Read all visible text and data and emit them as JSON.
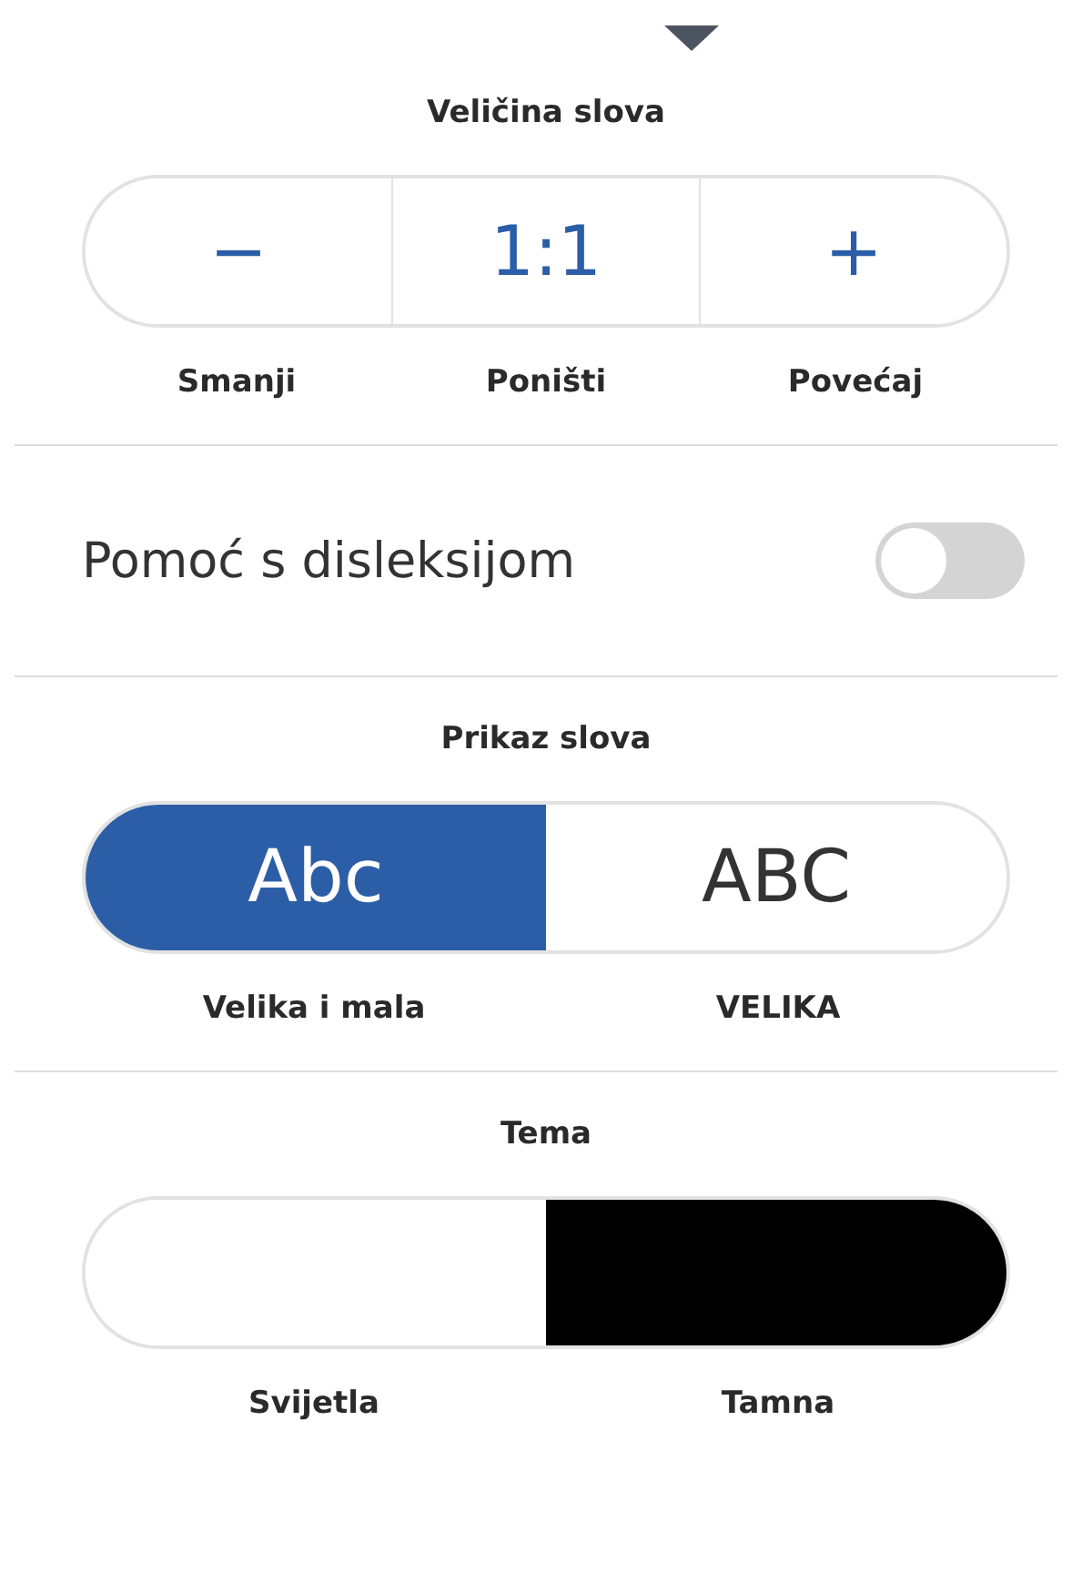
{
  "font_size": {
    "title": "Veličina slova",
    "buttons": [
      {
        "symbol": "−",
        "label": "Smanji"
      },
      {
        "symbol": "1:1",
        "label": "Poništi"
      },
      {
        "symbol": "+",
        "label": "Povećaj"
      }
    ]
  },
  "dyslexia": {
    "label": "Pomoć s disleksijom",
    "on": false
  },
  "letter_case": {
    "title": "Prikaz slova",
    "options": [
      {
        "sample": "Abc",
        "label": "Velika i mala",
        "selected": true
      },
      {
        "sample": "ABC",
        "label": "VELIKA",
        "selected": false
      }
    ]
  },
  "theme": {
    "title": "Tema",
    "options": [
      {
        "label": "Svijetla",
        "color": "#ffffff"
      },
      {
        "label": "Tamna",
        "color": "#000000"
      }
    ]
  }
}
